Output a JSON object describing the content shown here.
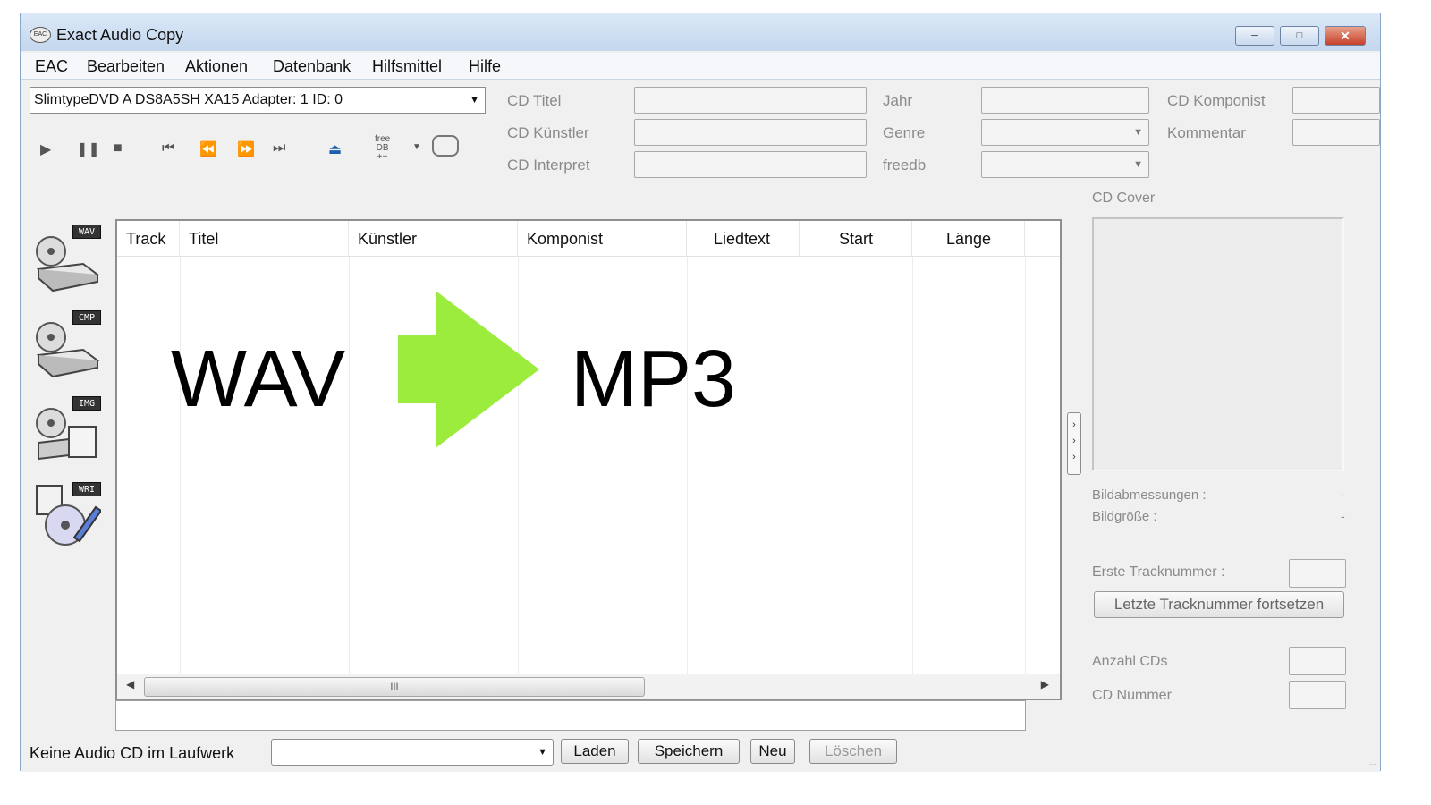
{
  "window": {
    "title": "Exact Audio Copy",
    "app_icon": "EAC",
    "controls": [
      "minimize-icon",
      "maximize-icon",
      "close-icon"
    ]
  },
  "menu": [
    "EAC",
    "Bearbeiten",
    "Aktionen",
    "Datenbank",
    "Hilfsmittel",
    "Hilfe"
  ],
  "drive": {
    "selected": "SlimtypeDVD A  DS8A5SH XA15   Adapter: 1  ID: 0"
  },
  "transport": {
    "icons": [
      "play-icon",
      "pause-icon",
      "stop-icon",
      "first-track-icon",
      "rewind-icon",
      "fast-forward-icon",
      "last-track-icon",
      "eject-icon",
      "freedb-icon",
      "antenna-icon"
    ],
    "freedb_label": "free\nDB\n++"
  },
  "cd_fields": {
    "title_label": "CD Titel",
    "artist_label": "CD Künstler",
    "performer_label": "CD Interpret",
    "year_label": "Jahr",
    "genre_label": "Genre",
    "freedb_label": "freedb",
    "composer_label": "CD Komponist",
    "comment_label": "Kommentar"
  },
  "tracklist": {
    "columns": [
      "Track",
      "Titel",
      "Künstler",
      "Komponist",
      "Liedtext",
      "Start",
      "Länge"
    ],
    "rows": [],
    "scroll_thumb_label": "III"
  },
  "overlay": {
    "from": "WAV",
    "to": "MP3",
    "arrow_color": "#9cec3e"
  },
  "sidebar": {
    "actions": [
      {
        "badge": "WAV",
        "icon": "copy-wav-icon"
      },
      {
        "badge": "CMP",
        "icon": "compress-icon"
      },
      {
        "badge": "IMG",
        "icon": "image-icon"
      },
      {
        "badge": "WRI",
        "icon": "write-cd-icon"
      }
    ]
  },
  "cover": {
    "label": "CD Cover",
    "dimensions_label": "Bildabmessungen :",
    "dimensions_value": "-",
    "size_label": "Bildgröße :",
    "size_value": "-"
  },
  "track_numbering": {
    "first_label": "Erste Tracknummer :",
    "continue_button": "Letzte Tracknummer fortsetzen",
    "cd_count_label": "Anzahl CDs",
    "cd_number_label": "CD Nummer"
  },
  "status": {
    "text": "Keine Audio CD im Laufwerk",
    "load": "Laden",
    "save": "Speichern",
    "new": "Neu",
    "delete": "Löschen"
  },
  "colors": {
    "titlebar": "#c4d7ee",
    "window_bg": "#f0f0f0",
    "close_button": "#c6402a",
    "arrow": "#9cec3e"
  }
}
